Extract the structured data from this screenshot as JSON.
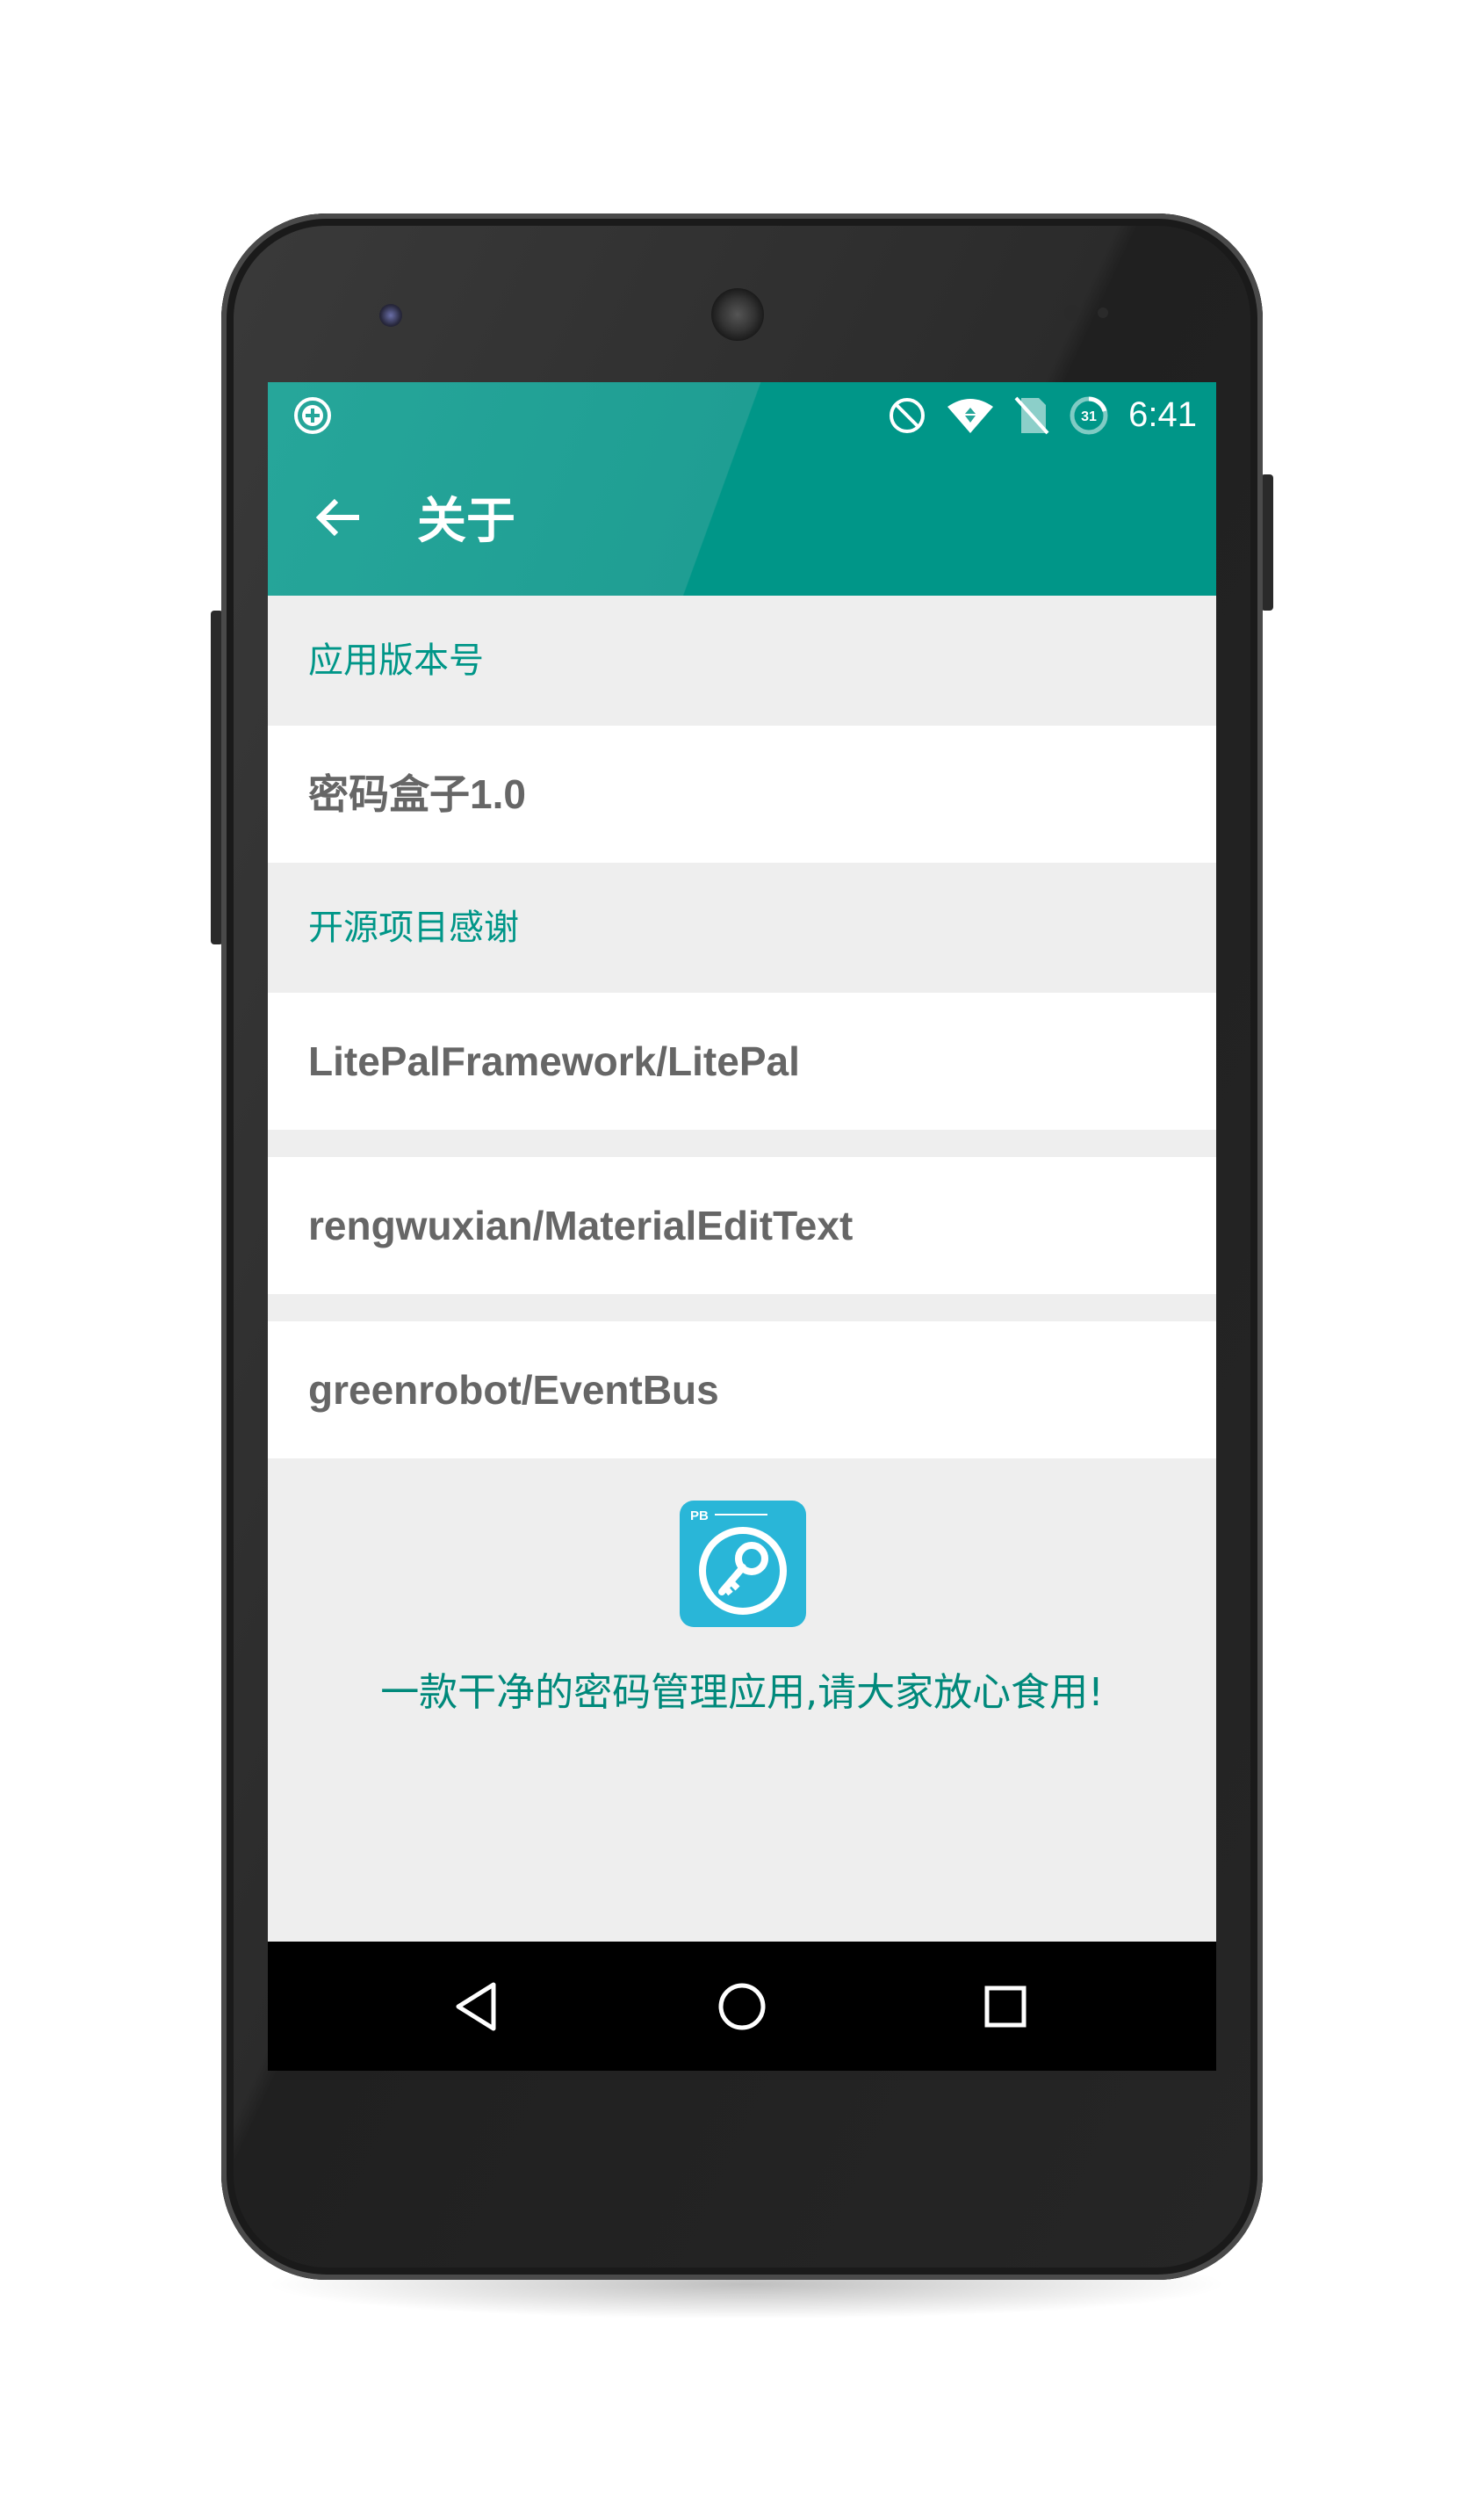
{
  "statusbar": {
    "time": "6:41",
    "left_icon": "add-circle-icon",
    "icons": [
      "do-not-disturb-icon",
      "wifi-icon",
      "no-sim-icon",
      "battery-icon"
    ],
    "battery_level_label": "31"
  },
  "toolbar": {
    "back_icon": "arrow-back-icon",
    "title": "关于",
    "background_color": "#009688"
  },
  "sections": {
    "version": {
      "header": "应用版本号",
      "value": "密码盒子1.0"
    },
    "thanks": {
      "header": "开源项目感谢",
      "items": [
        {
          "label": "LitePalFramework/LitePal"
        },
        {
          "label": "rengwuxian/MaterialEditText"
        },
        {
          "label": "greenrobot/EventBus"
        }
      ]
    }
  },
  "footer": {
    "logo_icon": "key-icon",
    "logo_badge": "PB",
    "tagline": "一款干净的密码管理应用,请大家放心食用!"
  },
  "navbar": {
    "buttons": [
      "back-triangle-icon",
      "home-circle-icon",
      "recents-square-icon"
    ]
  },
  "colors": {
    "accent": "#009688",
    "header_text": "#009688",
    "item_text": "#666666",
    "background": "#eeeeee"
  }
}
